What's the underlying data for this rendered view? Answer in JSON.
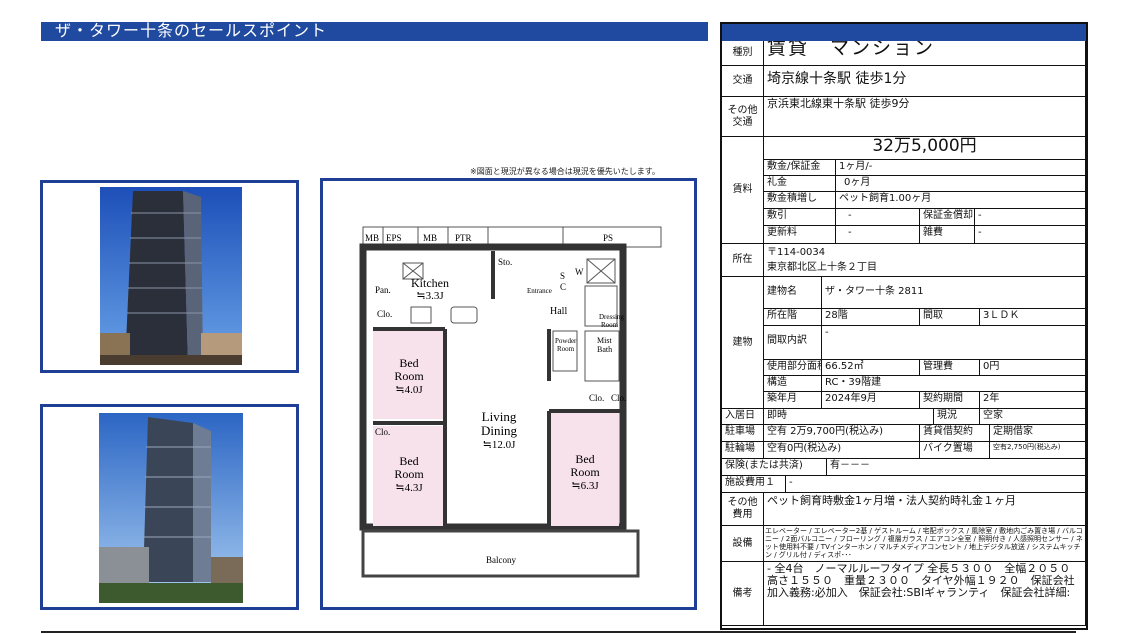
{
  "section_title": "ザ・タワー十条のセールスポイント",
  "plan_note": "※図面と現況が異なる場合は現況を優先いたします。",
  "floor_plan": {
    "rooms": {
      "kitchen": "Kitchen",
      "kitchen_size": "≒3.3J",
      "bed1": "Bed",
      "bed1_b": "Room",
      "bed1_size": "≒4.0J",
      "bed2": "Bed",
      "bed2_b": "Room",
      "bed2_size": "≒4.3J",
      "bed3": "Bed",
      "bed3_b": "Room",
      "bed3_size": "≒6.3J",
      "living": "Living",
      "dining": "Dining",
      "living_size": "≒12.0J",
      "hall": "Hall",
      "balcony": "Balcony",
      "powder": "Powder",
      "powder_b": "Room",
      "mist": "Mist",
      "bath": "Bath",
      "dressing": "Dressing",
      "dressing_b": "Room",
      "entrance": "Entrance",
      "pan": "Pan.",
      "clo": "Clo.",
      "sto": "Sto.",
      "s": "S",
      "c": "C",
      "w": "W",
      "mb": "MB",
      "eps": "EPS",
      "ptr": "PTR",
      "ps": "PS"
    }
  },
  "spec": {
    "type_label": "種別",
    "type_value": "賃貸　マンション",
    "transit_label": "交通",
    "transit_value": "埼京線十条駅 徒歩1分",
    "other_transit_label": "その他交通",
    "other_transit_value": "京浜東北線東十条駅 徒歩9分",
    "rent_label": "賃料",
    "rent_value": "32万5,000円",
    "deposit_label": "敷金/保証金",
    "deposit_value": "1ヶ月/-",
    "key_money_label": "礼金",
    "key_money_value": "0ヶ月",
    "deposit_add_label": "敷金積増し",
    "deposit_add_value": "ペット飼育1.00ヶ月",
    "shikibiki_label": "敷引",
    "shikibiki_value": "-",
    "guarantee_label": "保証金償却",
    "guarantee_value": "-",
    "renewal_label": "更新料",
    "renewal_value": "-",
    "misc_label": "雑費",
    "misc_value": "-",
    "address_label": "所在",
    "zip": "〒114-0034",
    "address": "東京都北区上十条２丁目",
    "building_label": "建物",
    "bname_label": "建物名",
    "bname_value": "ザ・タワー十条 2811",
    "floor_label": "所在階",
    "floor_value": "28階",
    "layout_label": "間取",
    "layout_value": "3ＬＤＫ",
    "layout_detail_label": "間取内訳",
    "layout_detail_value": "-",
    "area_label": "使用部分面積",
    "area_value": "66.52㎡",
    "mgmt_label": "管理費",
    "mgmt_value": "0円",
    "structure_label": "構造",
    "structure_value": "RC・39階建",
    "built_label": "築年月",
    "built_value": "2024年9月",
    "contract_period_label": "契約期間",
    "contract_period_value": "2年",
    "move_label": "入居日",
    "move_value": "即時",
    "status_label": "現況",
    "status_value": "空家",
    "parking_label": "駐車場",
    "parking_value": "空有 2万9,700円(税込み)",
    "lease_label": "賃貸借契約",
    "lease_value": "定期借家",
    "bike_label": "駐輪場",
    "bike_value": "空有0円(税込み)",
    "moto_label": "バイク置場",
    "moto_value": "空有2,750円(税込み)",
    "insurance_label": "保険(または共済)",
    "insurance_value": "有－－－",
    "facility_fee_label": "施設費用１",
    "facility_fee_value": "-",
    "other_cost_label": "その他費用",
    "other_cost_value": "ペット飼育時敷金1ヶ月増・法人契約時礼金１ヶ月",
    "equip_label": "設備",
    "equip_value": "エレベーター / エレベーター2基 / ゲストルーム / 宅配ボックス / 風除室 / 敷地内ごみ置き場 / バルコニー / 2面バルコニー / フローリング / 複層ガラス / エアコン全室 / 照明付き / 人感照明センサー / ネット使用料不要 / TVインターホン / マルチメディアコンセント / 地上デジタル放送 / システムキッチン / グリル付 / ディスポ･･･",
    "remarks_label": "備考",
    "remarks_value": "- 全4台　ノーマルルーフタイプ 全長５３００　全幅２０５０　高さ１５５０　重量２３００　タイヤ外幅１９２０　保証会社加入義務:必加入　保証会社:SBIギャランティ　保証会社詳細:"
  }
}
